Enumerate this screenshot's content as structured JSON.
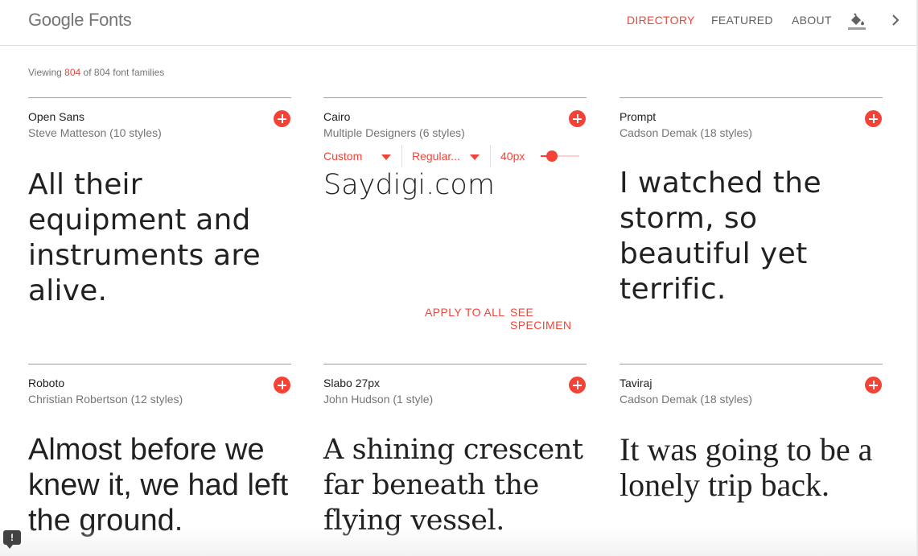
{
  "header": {
    "logo": "Google Fonts",
    "nav": [
      {
        "label": "DIRECTORY",
        "active": true
      },
      {
        "label": "FEATURED",
        "active": false
      },
      {
        "label": "ABOUT",
        "active": false
      }
    ],
    "icons": [
      "paint-bucket-icon",
      "chevron-right-icon"
    ]
  },
  "viewing": {
    "prefix": "Viewing",
    "count": "804",
    "middle": "of",
    "total": "804",
    "suffix": "font families"
  },
  "cards": [
    {
      "name": "Open Sans",
      "designer": "Steve Matteson (10 styles)",
      "sample": "All their equipment and instruments are alive."
    },
    {
      "name": "Cairo",
      "designer": "Multiple Designers (6 styles)",
      "sample": "Saydigi.com",
      "controls": {
        "preset": "Custom",
        "style": "Regular...",
        "size": "40px",
        "size_level": 0.3
      },
      "links": {
        "apply": "APPLY TO ALL",
        "specimen": "SEE SPECIMEN"
      }
    },
    {
      "name": "Prompt",
      "designer": "Cadson Demak (18 styles)",
      "sample": "I watched the storm, so beautiful yet terrific."
    },
    {
      "name": "Roboto",
      "designer": "Christian Robertson (12 styles)",
      "sample": "Almost before we knew it, we had left the ground."
    },
    {
      "name": "Slabo 27px",
      "designer": "John Hudson (1 style)",
      "sample": "A shining crescent far beneath the flying vessel."
    },
    {
      "name": "Taviraj",
      "designer": "Cadson Demak (18 styles)",
      "sample": "It was going to be a lonely trip back."
    }
  ],
  "feedback": {
    "label": "!"
  },
  "colors": {
    "accent": "#f44336",
    "text": "#212121",
    "secondary": "#757575"
  }
}
